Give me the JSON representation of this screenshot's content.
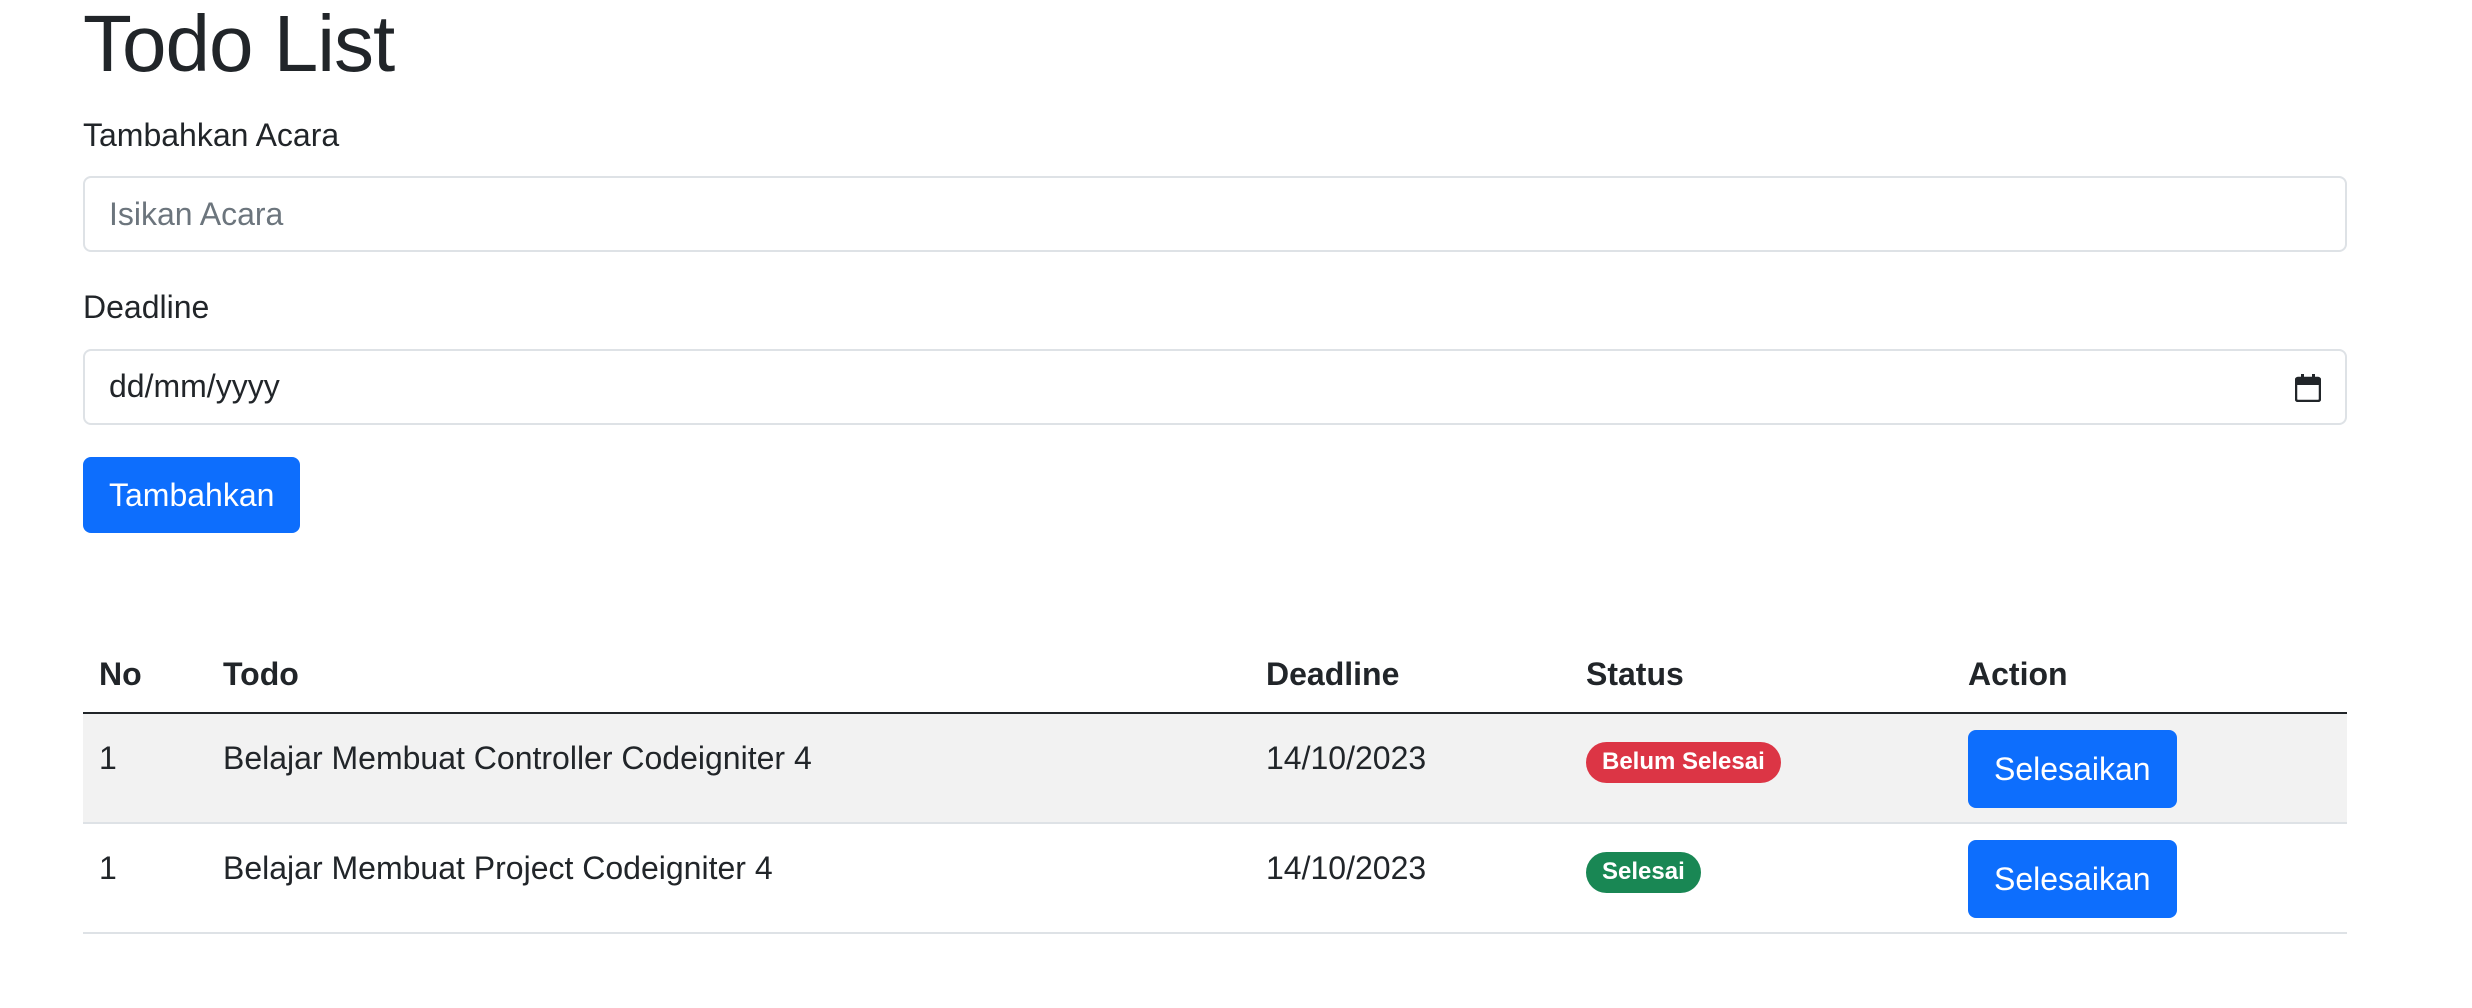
{
  "page": {
    "title": "Todo List"
  },
  "form": {
    "event_label": "Tambahkan Acara",
    "event_placeholder": "Isikan Acara",
    "deadline_label": "Deadline",
    "deadline_value": "dd/mm/yyyy",
    "submit_label": "Tambahkan"
  },
  "table": {
    "headers": {
      "no": "No",
      "todo": "Todo",
      "deadline": "Deadline",
      "status": "Status",
      "action": "Action"
    },
    "rows": [
      {
        "no": "1",
        "todo": "Belajar Membuat Controller Codeigniter 4",
        "deadline": "14/10/2023",
        "status": "Belum Selesai",
        "action": "Selesaikan"
      },
      {
        "no": "1",
        "todo": "Belajar Membuat Project Codeigniter 4",
        "deadline": "14/10/2023",
        "status": "Selesai",
        "action": "Selesaikan"
      }
    ]
  },
  "colors": {
    "primary": "#0d6efd",
    "danger": "#dc3545",
    "success": "#198754",
    "stripe": "#f2f2f2"
  },
  "icons": {
    "date_picker": "calendar-icon"
  }
}
